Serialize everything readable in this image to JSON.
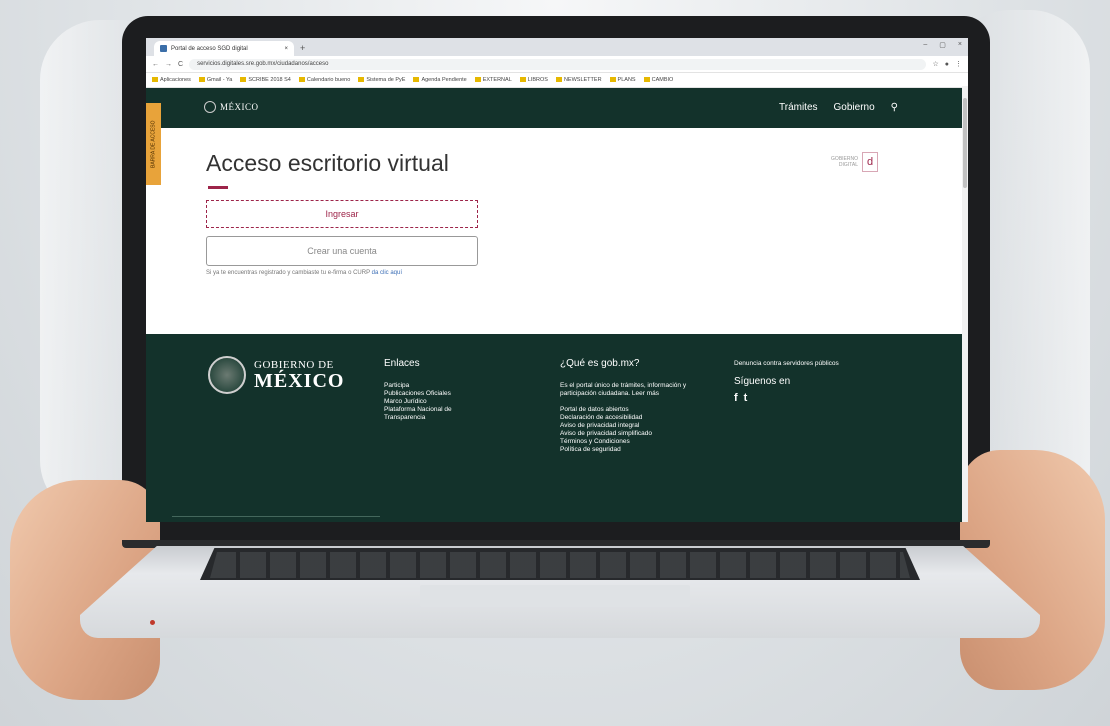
{
  "browser": {
    "tab_title": "Portal de acceso SGD digital",
    "tab_close": "×",
    "new_tab": "+",
    "window_controls": [
      "–",
      "▢",
      "×"
    ],
    "url": "servicios.digitales.sre.gob.mx/ciudadanos/acceso",
    "nav_back": "←",
    "nav_forward": "→",
    "nav_reload": "C",
    "bookmarks": [
      "Aplicaciones",
      "Gmail - Ya",
      "SCRIBE 2018 S4",
      "Calendario bueno",
      "Sistema de PyE",
      "Agenda Pendiente",
      "EXTERNAL",
      "LIBROS",
      "NEWSLETTER",
      "PLANS",
      "CAMBIO"
    ]
  },
  "navbar": {
    "logo_text": "MÉXICO",
    "links": [
      "Trámites",
      "Gobierno"
    ],
    "search_icon": "search-icon"
  },
  "side_tag": "BARRA DE ACCESO",
  "main": {
    "title": "Acceso escritorio virtual",
    "ingresar_label": "Ingresar",
    "crear_label": "Crear una cuenta",
    "note_text": "Si ya te encuentras registrado y cambiaste tu e-firma o CURP ",
    "note_link": "da clic aquí",
    "gob_digital_line1": "GOBIERNO",
    "gob_digital_line2": "DIGITAL",
    "gob_digital_mark": "d"
  },
  "footer": {
    "logo_line1": "GOBIERNO DE",
    "logo_line2": "MÉXICO",
    "enlaces": {
      "title": "Enlaces",
      "items": [
        "Participa",
        "Publicaciones Oficiales",
        "Marco Jurídico",
        "Plataforma Nacional de Transparencia"
      ]
    },
    "que_es": {
      "title": "¿Qué es gob.mx?",
      "description": "Es el portal único de trámites, información y participación ciudadana. Leer más",
      "items": [
        "Portal de datos abiertos",
        "Declaración de accesibilidad",
        "Aviso de privacidad integral",
        "Aviso de privacidad simplificado",
        "Términos y Condiciones",
        "Política de seguridad"
      ]
    },
    "contacto": {
      "denuncia": "Denuncia contra servidores públicos",
      "siguenos": "Síguenos en",
      "social": [
        "f",
        "t"
      ]
    }
  }
}
